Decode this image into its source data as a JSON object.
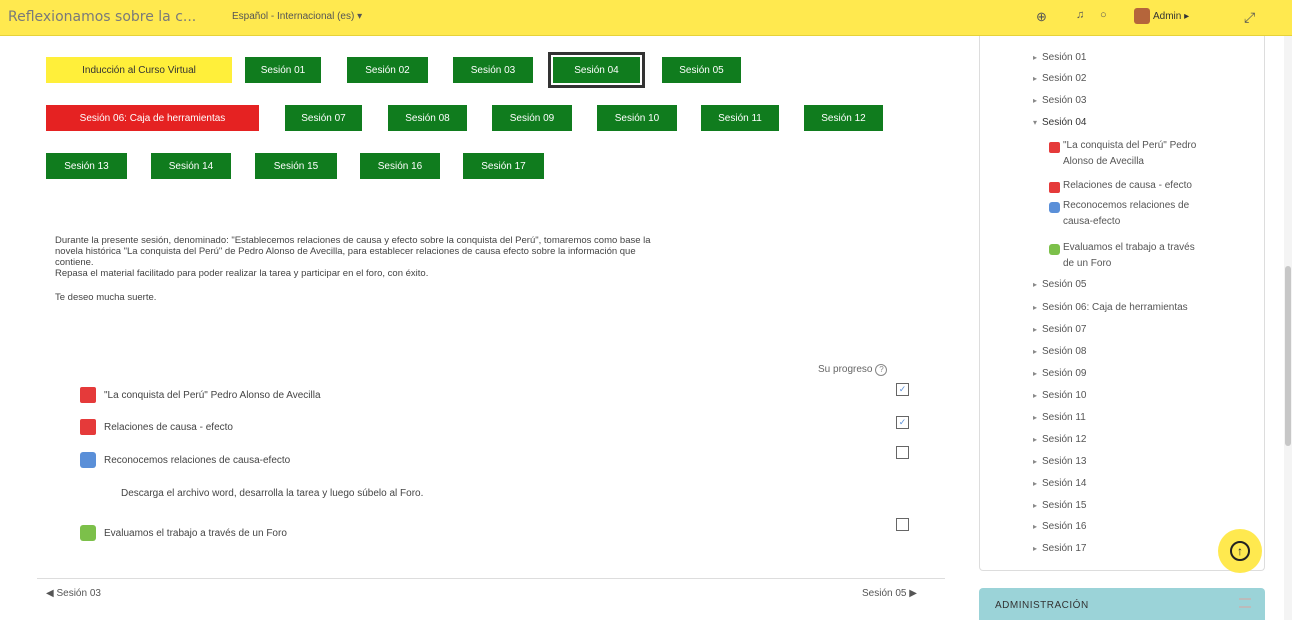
{
  "header": {
    "site_title": "Reflexionamos sobre la c...",
    "language": "Español - Internacional (es) ▾",
    "user": "Admin ▸"
  },
  "session_nav": {
    "row1": [
      "Inducción al Curso Virtual",
      "Sesión 01",
      "Sesión 02",
      "Sesión 03",
      "Sesión 04",
      "Sesión 05"
    ],
    "row2": [
      "Sesión 06: Caja de herramientas",
      "Sesión 07",
      "Sesión 08",
      "Sesión 09",
      "Sesión 10",
      "Sesión 11",
      "Sesión 12"
    ],
    "row3": [
      "Sesión 13",
      "Sesión 14",
      "Sesión 15",
      "Sesión 16",
      "Sesión 17"
    ],
    "selected": "Sesión 04"
  },
  "summary": {
    "p1_line1": "Durante la presente sesión, denominado: \"Establecemos relaciones de causa y efecto sobre la conquista del Perú\", tomaremos como base la",
    "p1_line2": "novela histórica \"La conquista del Perú\"  de Pedro Alonso de Avecilla, para establecer relaciones de causa efecto sobre la información que",
    "p1_line3": "contiene.",
    "p2": "Repasa el material facilitado para poder realizar  la tarea y participar en el foro, con éxito.",
    "p3": "Te deseo mucha suerte."
  },
  "progress": {
    "label": "Su progreso"
  },
  "activities": [
    {
      "name": "\"La conquista del Perú\" Pedro Alonso de Avecilla",
      "icon": "pdf-icon",
      "done": true
    },
    {
      "name": "Relaciones de causa - efecto",
      "icon": "pdf-icon",
      "done": true
    },
    {
      "name": "Reconocemos relaciones de causa-efecto",
      "icon": "url-icon",
      "done": false
    },
    {
      "name": "Evaluamos el trabajo a través de un Foro",
      "icon": "forum-icon",
      "done": false
    }
  ],
  "activity_description": "Descarga el archivo word, desarrolla la tarea y luego súbelo al Foro.",
  "footer_nav": {
    "prev": "◀ Sesión 03",
    "next": "Sesión 05 ▶"
  },
  "sidebar": {
    "items_before": [
      "Sesión 01",
      "Sesión 02",
      "Sesión 03"
    ],
    "expanded": "Sesión 04",
    "expanded_children": [
      {
        "line1": "\"La conquista del Perú\" Pedro",
        "line2": "Alonso de Avecilla"
      },
      {
        "line1": "Relaciones de causa - efecto",
        "line2": ""
      },
      {
        "line1": "Reconocemos relaciones de",
        "line2": "causa-efecto"
      },
      {
        "line1": "Evaluamos el trabajo a través",
        "line2": "de un Foro"
      }
    ],
    "items_after": [
      "Sesión 05",
      "Sesión 06: Caja de herramientas",
      "Sesión 07",
      "Sesión 08",
      "Sesión 09",
      "Sesión 10",
      "Sesión 11",
      "Sesión 12",
      "Sesión 13",
      "Sesión 14",
      "Sesión 15",
      "Sesión 16",
      "Sesión 17"
    ]
  },
  "admin_block": {
    "title": "ADMINISTRACIÓN"
  },
  "colors": {
    "header": "#ffe94f",
    "session_button": "#107c1e",
    "tools_button": "#e52222",
    "induction_button": "#ffef3a"
  }
}
